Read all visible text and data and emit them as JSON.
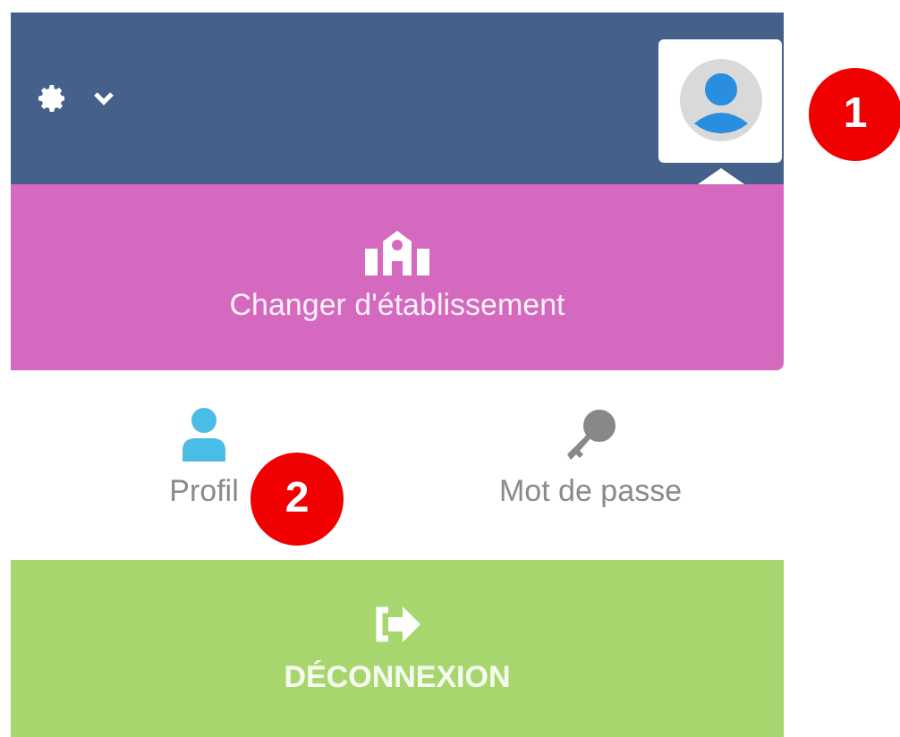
{
  "header": {
    "settings_menu": {
      "expanded": false
    }
  },
  "account_menu": {
    "switch_school": {
      "label": "Changer d'établissement"
    },
    "links": [
      {
        "kind": "profile",
        "label": "Profil"
      },
      {
        "kind": "password",
        "label": "Mot de passe"
      }
    ],
    "logout": {
      "label": "DÉCONNEXION"
    }
  },
  "callouts": [
    {
      "label": "1"
    },
    {
      "label": "2"
    }
  ]
}
